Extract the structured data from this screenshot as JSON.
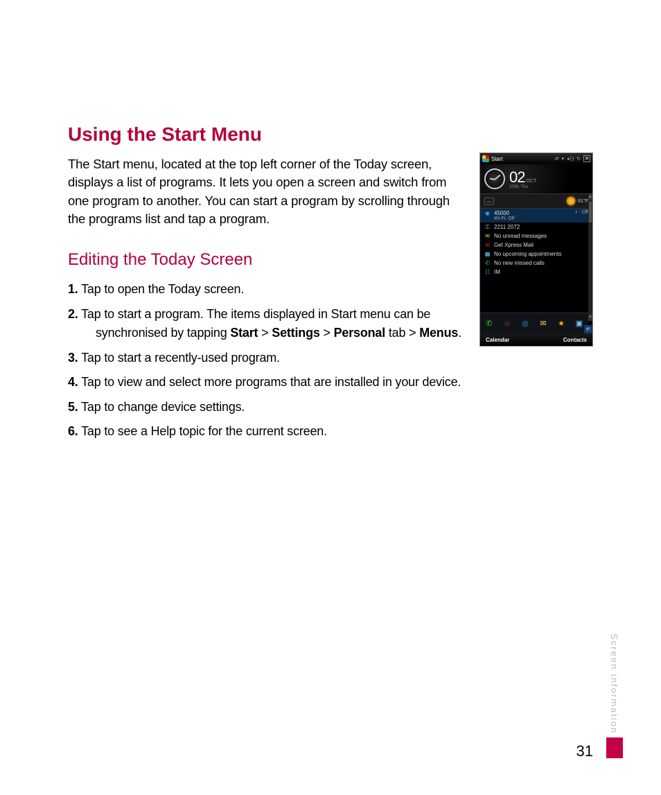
{
  "title": "Using the Start Menu",
  "intro": "The Start menu, located at the top left corner of the Today screen, displays a list of programs. It lets you open a screen and switch from one program to another. You can start a program by scrolling through the programs list and tap a program.",
  "subTitle": "Editing the Today Screen",
  "steps": {
    "s1": {
      "num": "1.",
      "text": "Tap to open the Today screen."
    },
    "s2": {
      "num": "2.",
      "lead": "Tap to start a program. The items displayed in Start menu can be",
      "cont_pre": "synchronised by tapping ",
      "b1": "Start",
      "g1": " > ",
      "b2": "Settings",
      "g2": " > ",
      "b3": "Personal",
      "g3": " tab > ",
      "b4": "Menus",
      "g4": "."
    },
    "s3": {
      "num": "3.",
      "text": "Tap to start a recently-used program."
    },
    "s4": {
      "num": "4.",
      "text": "Tap to view and select more programs that are installed in your device."
    },
    "s5": {
      "num": "5.",
      "text": "Tap to change device settings."
    },
    "s6": {
      "num": "6.",
      "text": "Tap to see a Help topic for the current screen."
    }
  },
  "phone": {
    "start": "Start",
    "statusIcons": "⇄ ▾ ◂)) ↻",
    "day": "02",
    "month": "OCT",
    "year": "2008, Thu",
    "temp": "61°F",
    "rows": {
      "ph": "45000",
      "wifi": "Wi-Fi: Off",
      "btLabel": ": Off",
      "phnum": "2211 2072",
      "msg": "No unread messages",
      "mail": "Get Xpress Mail",
      "appt": "No upcoming appointments",
      "calls": "No new missed calls",
      "im": "IM"
    },
    "softLeft": "Calendar",
    "softRight": "Contacts"
  },
  "sideLabel": "Screen information",
  "pageNum": "31"
}
